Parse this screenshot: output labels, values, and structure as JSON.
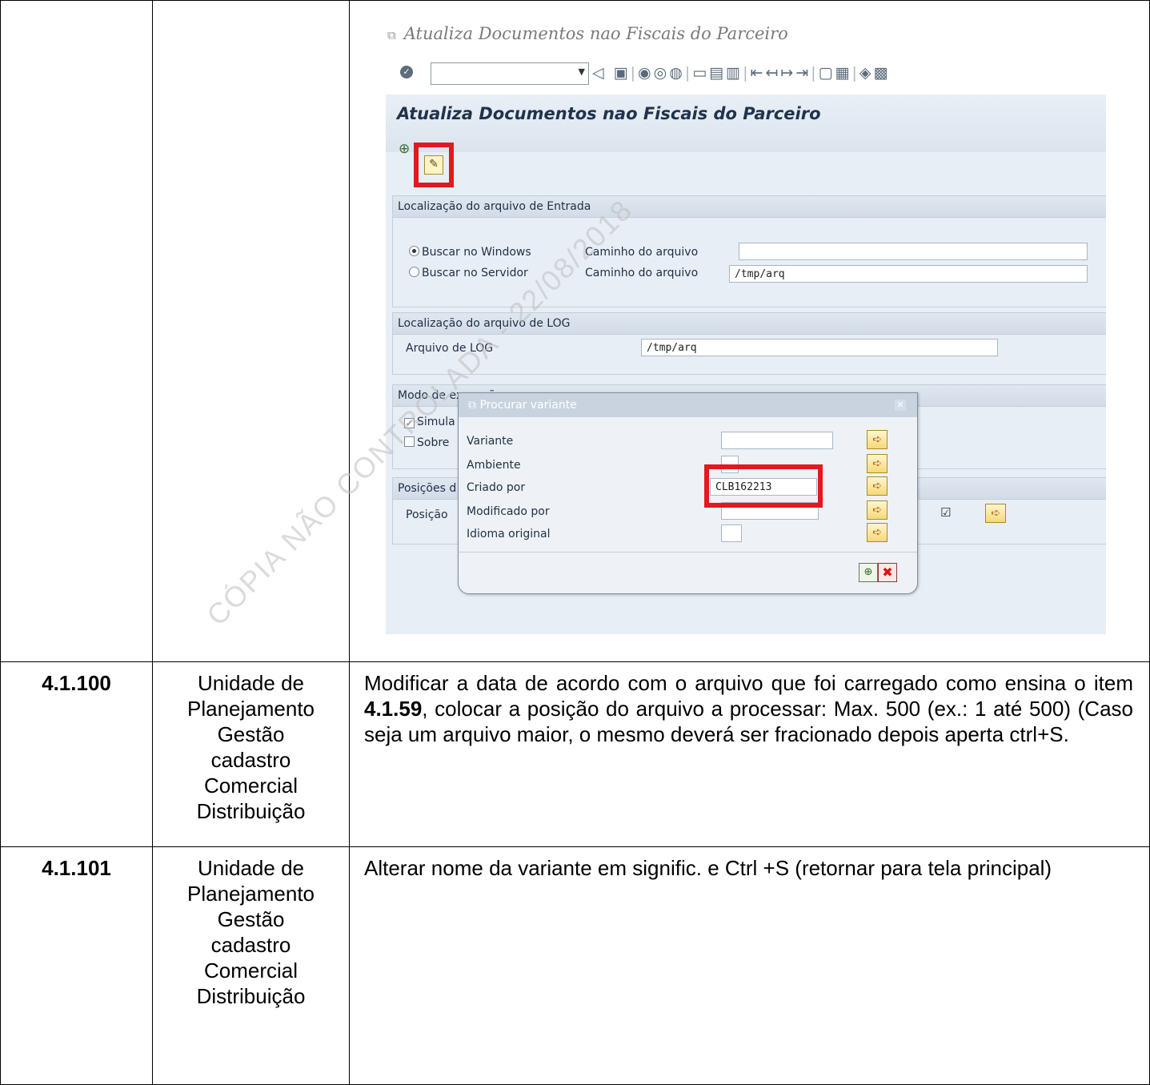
{
  "sap": {
    "window_title": "Atualiza Documentos nao Fiscais do Parceiro",
    "app_title": "Atualiza Documentos nao Fiscais do Parceiro",
    "command_field_value": "",
    "group_entrada": {
      "header": "Localização do arquivo de Entrada",
      "radio_windows": "Buscar no Windows",
      "radio_servidor": "Buscar no Servidor",
      "path_label_1": "Caminho do arquivo",
      "path_value_1": "",
      "path_label_2": "Caminho do arquivo",
      "path_value_2": "/tmp/arq"
    },
    "group_log": {
      "header": "Localização do arquivo de LOG",
      "label": "Arquivo de LOG",
      "value": "/tmp/arq"
    },
    "group_modo": {
      "header": "Modo de execução",
      "cb_1": "Simula",
      "cb_2": "Sobre"
    },
    "group_pos": {
      "header": "Posições d",
      "label": "Posição"
    },
    "popup": {
      "title": "Procurar variante",
      "variante_label": "Variante",
      "variante_value": "",
      "ambiente_label": "Ambiente",
      "criado_label": "Criado por",
      "criado_value": "CLB162213",
      "modificado_label": "Modificado por",
      "modificado_value": "",
      "idioma_label": "Idioma original",
      "idioma_value": ""
    }
  },
  "rows": [
    {
      "step": "4.1.100",
      "responsible": [
        "Unidade de",
        "Planejamento",
        "Gestão",
        "cadastro",
        "Comercial",
        "Distribuição"
      ],
      "desc_part1": "Modificar a data de acordo com o arquivo que foi carregado como ensina o item ",
      "desc_bold": "4.1.59",
      "desc_part2": ", colocar a posição do arquivo a processar: Max. 500 (ex.: 1 até 500) (Caso seja um arquivo maior, o mesmo deverá ser fracionado depois aperta ctrl+S."
    },
    {
      "step": "4.1.101",
      "responsible": [
        "Unidade de",
        "Planejamento",
        "Gestão",
        "cadastro",
        "Comercial",
        "Distribuição"
      ],
      "desc": "Alterar nome da variante em signific. e Ctrl +S (retornar para tela principal)"
    }
  ],
  "watermark": "CÓPIA NÃO CONTROLADA - 22/08/2018"
}
